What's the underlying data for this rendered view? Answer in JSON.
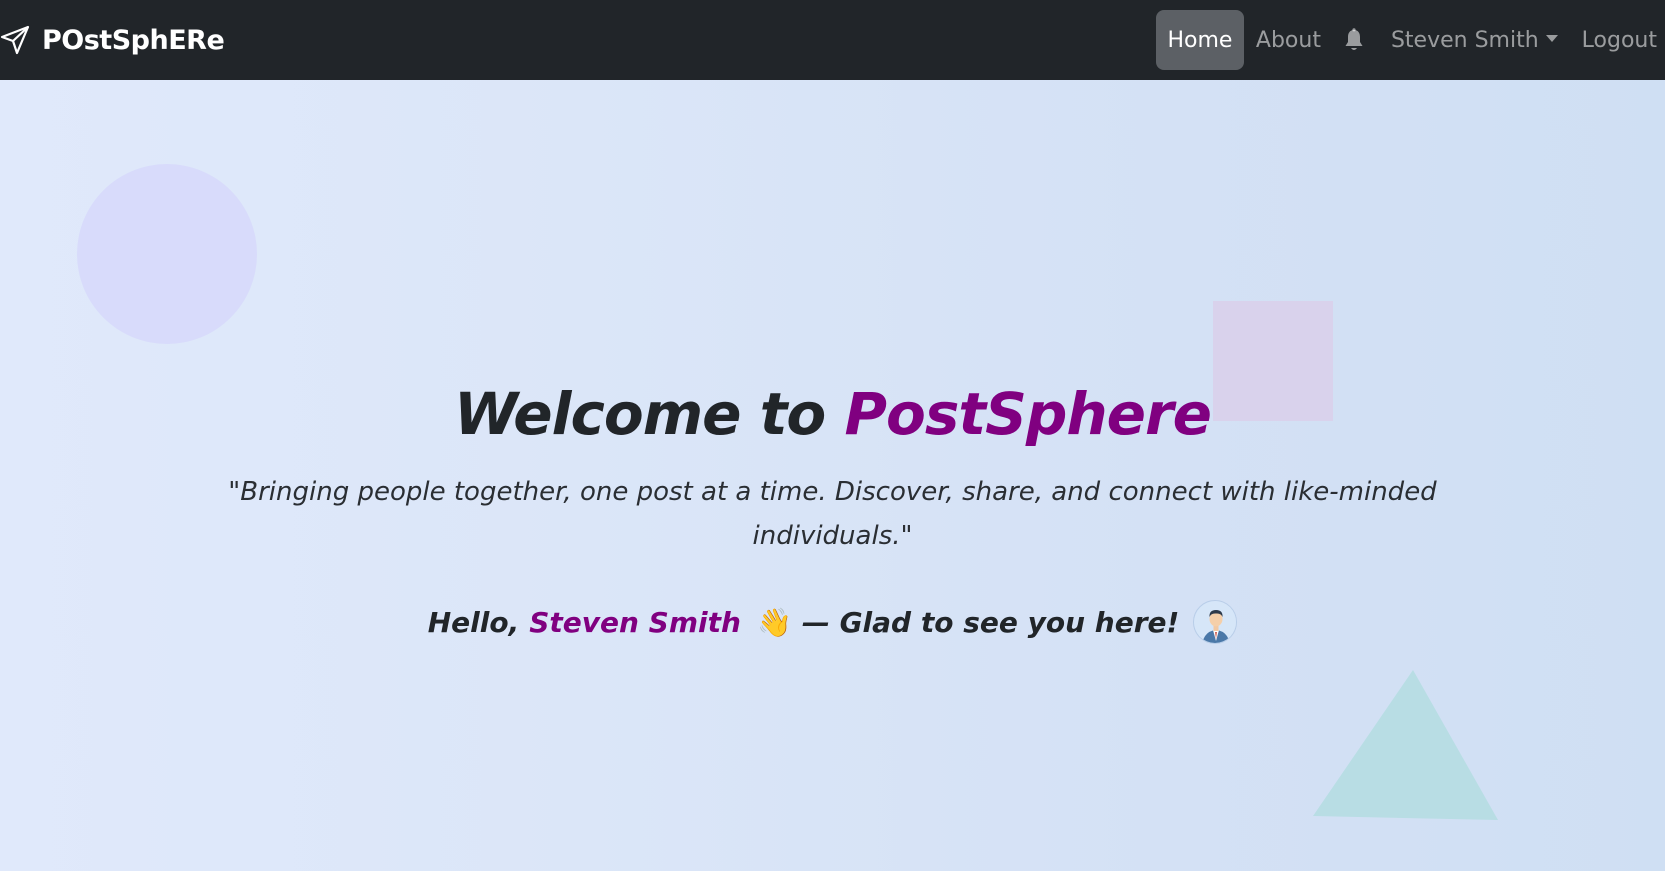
{
  "navbar": {
    "brand": "POstSphERe",
    "brand_icon": "paper-plane-icon",
    "links": {
      "home": "Home",
      "about": "About",
      "notifications_icon": "bell-icon",
      "user": "Steven Smith",
      "logout": "Logout"
    }
  },
  "hero": {
    "title_prefix": "Welcome to",
    "title_brand": "PostSphere",
    "tagline": "\"Bringing people together, one post at a time. Discover, share, and connect with like-minded individuals.\"",
    "greeting_prefix": "Hello,",
    "greeting_name": "Steven Smith",
    "greeting_emoji": "👋",
    "greeting_suffix": "— Glad to see you here!",
    "avatar_icon": "user-avatar-icon"
  },
  "colors": {
    "navbar_bg": "#212529",
    "accent_purple": "#800080",
    "active_pill": "#5c6065"
  }
}
